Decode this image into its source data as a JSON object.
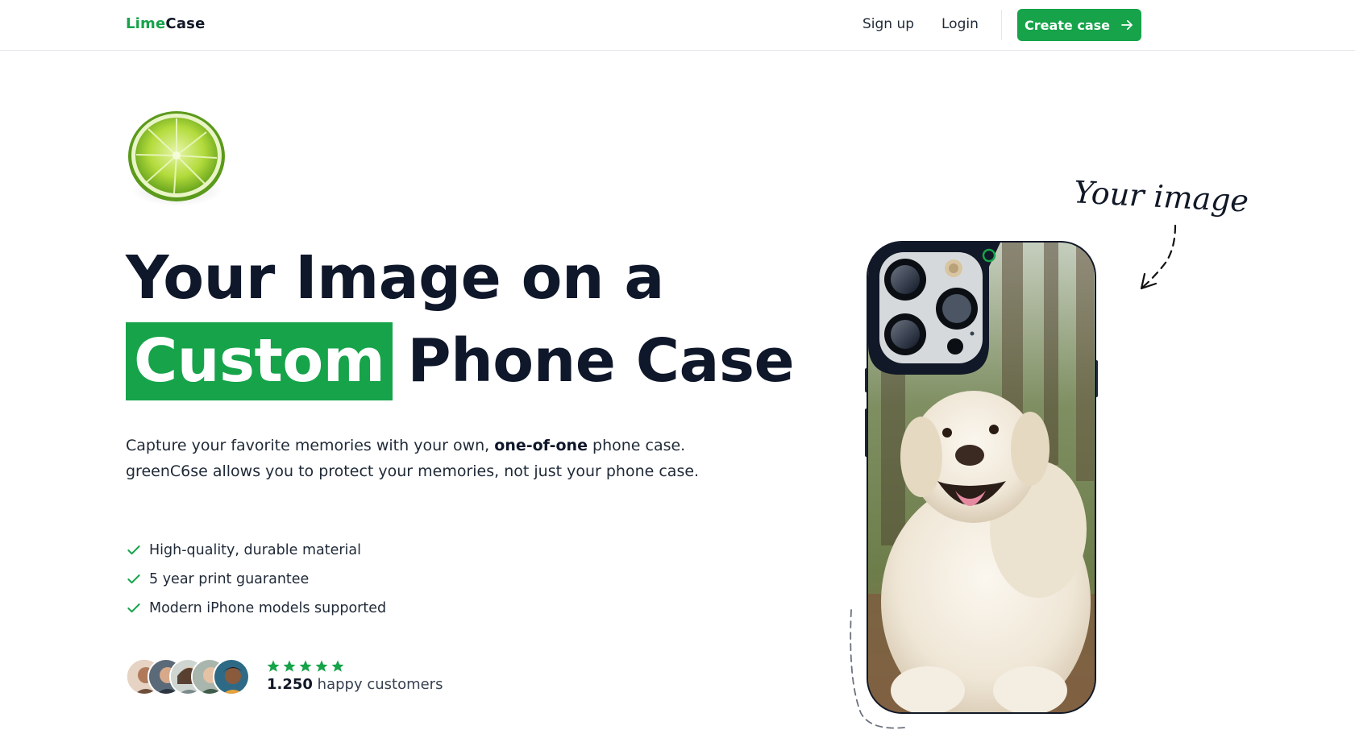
{
  "nav": {
    "logo_part1": "Lime",
    "logo_part2": "Case",
    "signup_label": "Sign up",
    "login_label": "Login",
    "cta_label": "Create case",
    "cta_icon": "arrow-right-icon"
  },
  "hero": {
    "title_line1": "Your Image on a",
    "title_highlight": "Custom",
    "title_line2_rest": "Phone Case",
    "description_pre": "Capture your favorite memories with your own, ",
    "description_bold": "one-of-one",
    "description_post": " phone case. greenC6se allows you to protect your memories, not just your phone case.",
    "features": [
      "High-quality, durable material",
      "5 year print guarantee",
      "Modern iPhone models supported"
    ],
    "rating_stars": 5,
    "customer_count": "1.250",
    "customer_suffix": " happy customers"
  },
  "showcase": {
    "handwritten_label": "Your image"
  },
  "colors": {
    "brand_green": "#16a34a",
    "text_dark": "#0f172a"
  }
}
